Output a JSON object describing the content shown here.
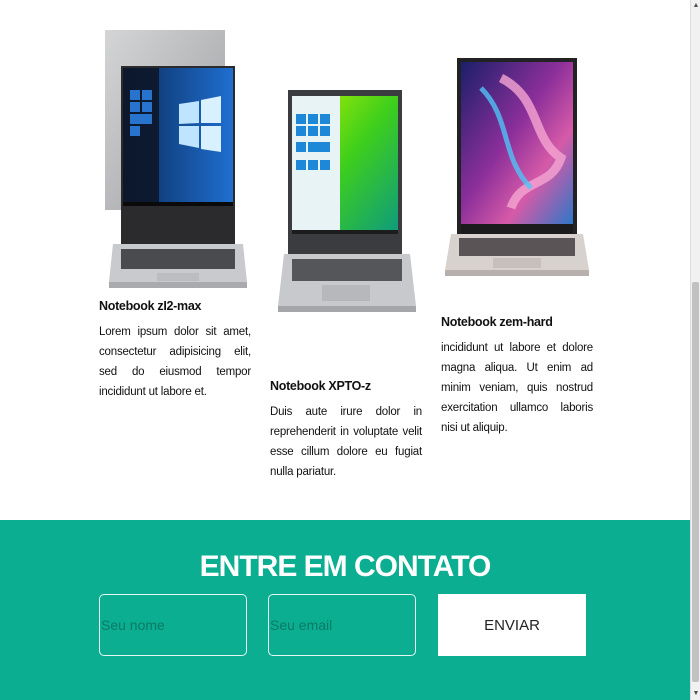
{
  "products": [
    {
      "title": "Notebook zI2-max",
      "description": "Lorem ipsum dolor sit amet, consectetur adipisicing elit, sed do eiusmod tempor incididunt ut labore et."
    },
    {
      "title": "Notebook XPTO-z",
      "description": "Duis aute irure dolor in reprehenderit in voluptate velit esse cillum dolore eu fugiat nulla pariatur."
    },
    {
      "title": "Notebook zem-hard",
      "description": "incididunt ut labore et dolore magna aliqua. Ut enim ad minim veniam, quis nostrud exercitation ullamco laboris nisi ut aliquip."
    }
  ],
  "contact": {
    "heading": "ENTRE EM CONTATO",
    "name_placeholder": "Seu nome",
    "email_placeholder": "Seu email",
    "submit_label": "ENVIAR"
  },
  "colors": {
    "contact_bg": "#0bae90"
  },
  "scrollbar": {
    "up_arrow": "▲",
    "down_arrow": "▼"
  }
}
